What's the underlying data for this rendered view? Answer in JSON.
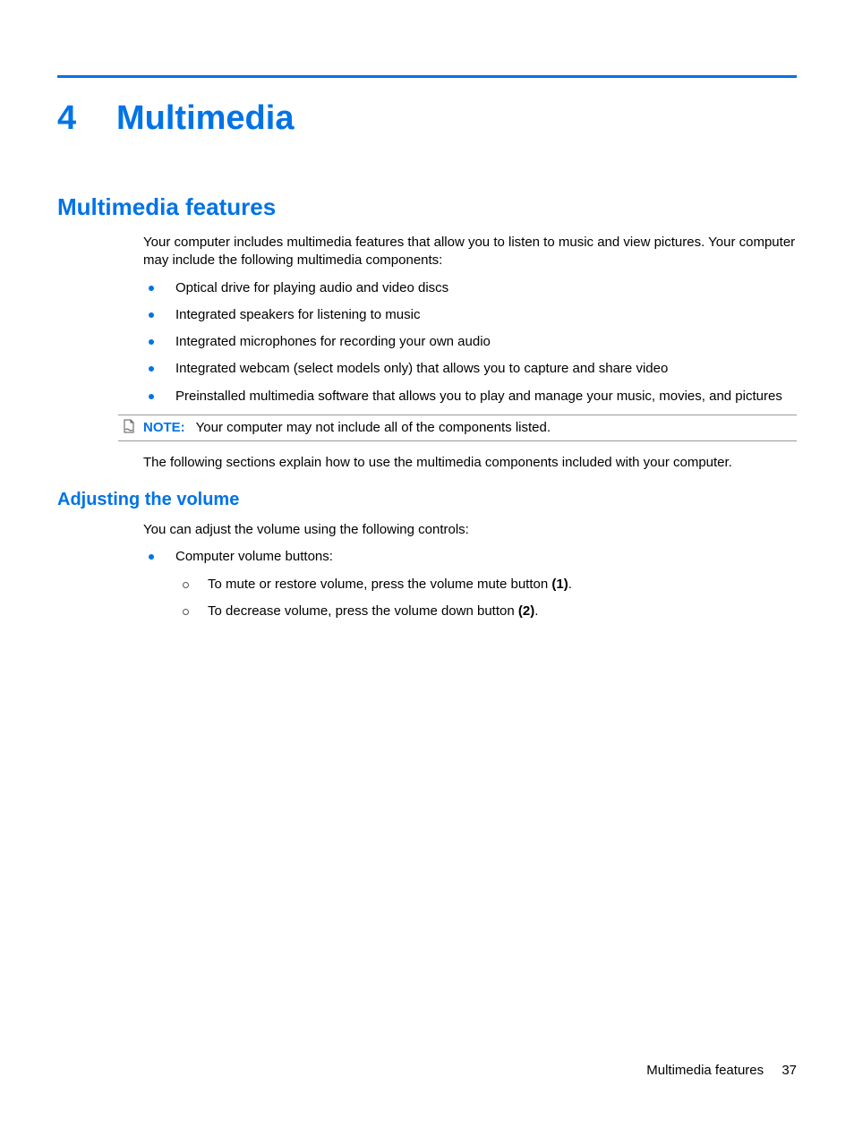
{
  "colors": {
    "accent": "#0073e6"
  },
  "chapter": {
    "number": "4",
    "title": "Multimedia"
  },
  "section1": {
    "heading": "Multimedia features",
    "intro": "Your computer includes multimedia features that allow you to listen to music and view pictures. Your computer may include the following multimedia components:",
    "bullets": [
      "Optical drive for playing audio and video discs",
      "Integrated speakers for listening to music",
      "Integrated microphones for recording your own audio",
      "Integrated webcam (select models only) that allows you to capture and share video",
      "Preinstalled multimedia software that allows you to play and manage your music, movies, and pictures"
    ],
    "note_label": "NOTE:",
    "note_text": "Your computer may not include all of the components listed.",
    "after_note": "The following sections explain how to use the multimedia components included with your computer."
  },
  "subsection1": {
    "heading": "Adjusting the volume",
    "intro": "You can adjust the volume using the following controls:",
    "bullet0": "Computer volume buttons:",
    "sub0_pre": "To mute or restore volume, press the volume mute button ",
    "sub0_bold": "(1)",
    "sub0_post": ".",
    "sub1_pre": "To decrease volume, press the volume down button ",
    "sub1_bold": "(2)",
    "sub1_post": "."
  },
  "footer": {
    "text": "Multimedia features",
    "page": "37"
  }
}
